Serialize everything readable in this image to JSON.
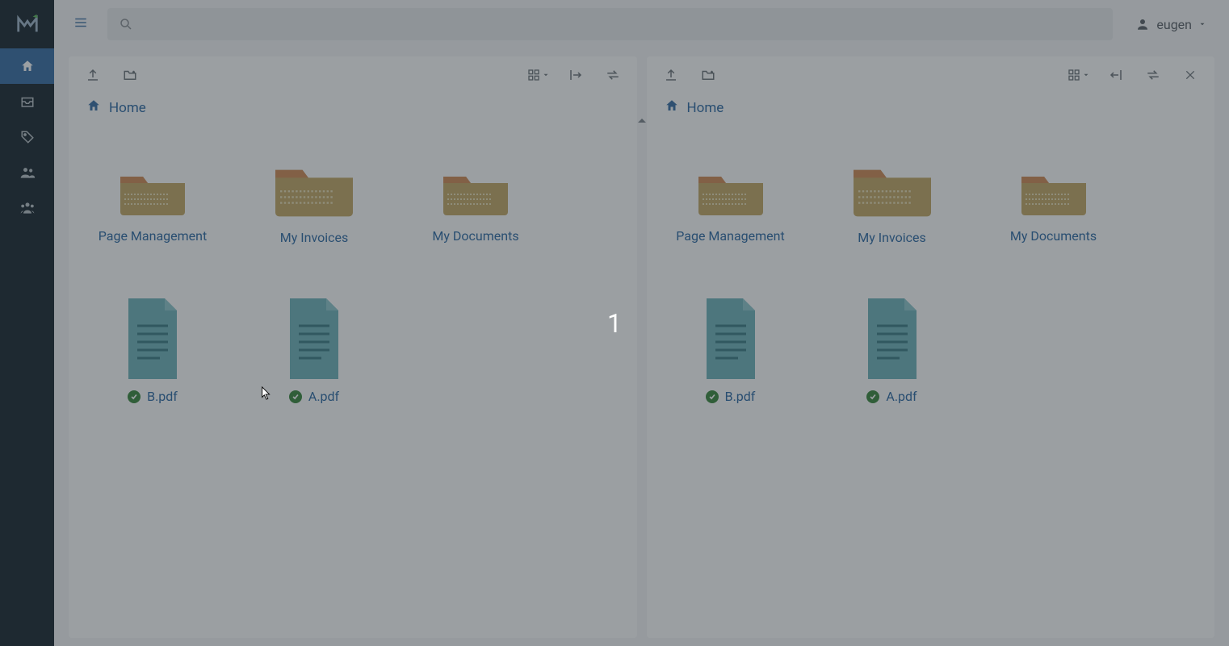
{
  "user": {
    "name": "eugen"
  },
  "search": {
    "placeholder": ""
  },
  "breadcrumb": {
    "home": "Home"
  },
  "overlay": {
    "count": "1"
  },
  "panes": {
    "left": {
      "items": [
        {
          "label": "Page Management",
          "type": "folder",
          "big": false
        },
        {
          "label": "My Invoices",
          "type": "folder",
          "big": true
        },
        {
          "label": "My Documents",
          "type": "folder",
          "big": false
        },
        {
          "label": "B.pdf",
          "type": "file",
          "badge": true
        },
        {
          "label": "A.pdf",
          "type": "file",
          "badge": true
        }
      ]
    },
    "right": {
      "items": [
        {
          "label": "Page Management",
          "type": "folder",
          "big": false
        },
        {
          "label": "My Invoices",
          "type": "folder",
          "big": true
        },
        {
          "label": "My Documents",
          "type": "folder",
          "big": false
        },
        {
          "label": "B.pdf",
          "type": "file",
          "badge": true
        },
        {
          "label": "A.pdf",
          "type": "file",
          "badge": true
        }
      ]
    }
  }
}
